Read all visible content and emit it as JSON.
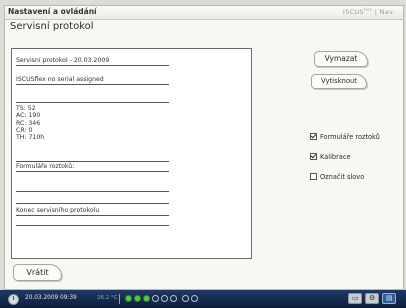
{
  "header": {
    "app_title": "Nastavení a ovládání",
    "brand": "ISCUS",
    "brand_suffix": "flex",
    "brand_extra": "| Nav."
  },
  "section_title": "Servisní protokol",
  "protocol": {
    "line1": "Servisní protokol - 20.03.2009",
    "line2": "ISCUSflex no serial assigned",
    "stats": [
      "TS: 52",
      "AC: 190",
      "RC: 346",
      "CR: 0",
      "TH: 710h"
    ],
    "formulare_label": "Formuláře roztoků:",
    "end_label": "Konec servisního protokolu"
  },
  "buttons": {
    "vymazat": "Vymazat",
    "vytisknout": "Vytisknout",
    "vratit": "Vrátit"
  },
  "options": [
    {
      "label": "Formuláře roztoků",
      "checked": true
    },
    {
      "label": "Kalibrace",
      "checked": true
    },
    {
      "label": "Označit slovo",
      "checked": false
    }
  ],
  "taskbar": {
    "datetime": "20.03.2009 09:39",
    "temperature": "26.2 °C",
    "leds": [
      true,
      true,
      true,
      false,
      false,
      false,
      false,
      false
    ],
    "icons": [
      "monitor-icon",
      "gear-icon",
      "chart-icon"
    ]
  }
}
